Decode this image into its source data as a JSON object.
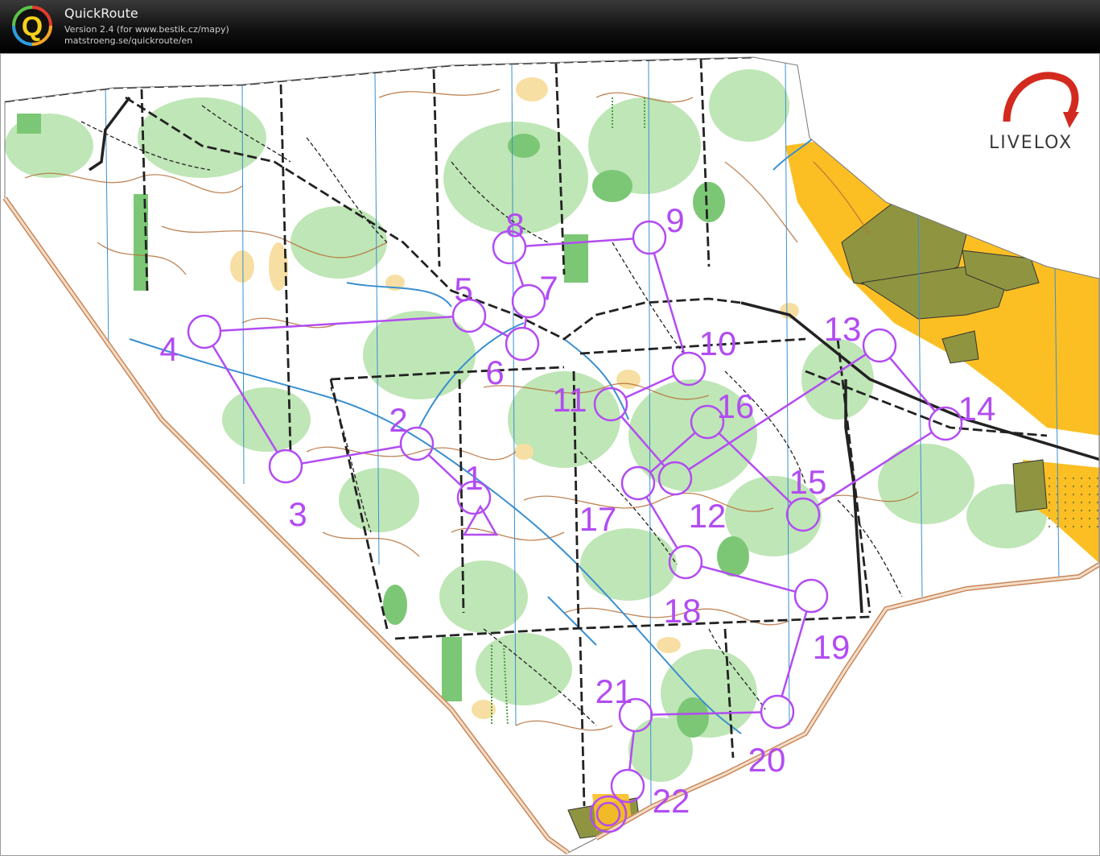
{
  "app": {
    "name": "QuickRoute",
    "version_line": "Version 2.4  (for www.bestik.cz/mapy)",
    "url_line": "matstroeng.se/quickroute/en",
    "logo_letter": "Q"
  },
  "brand": {
    "text": "LIVELOX"
  },
  "colors": {
    "course": "#b24cf2",
    "forest_green": "#a8dba0",
    "dark_green": "#6fbf6a",
    "open_yellow": "#fbbf24",
    "rough_open": "#f7e3a8",
    "olive": "#8f9440",
    "road": "#222222",
    "water": "#3a8fd0",
    "contour": "#b5703a"
  },
  "course": {
    "start_label": "",
    "controls": [
      {
        "number": "1"
      },
      {
        "number": "2"
      },
      {
        "number": "3"
      },
      {
        "number": "4"
      },
      {
        "number": "5"
      },
      {
        "number": "6"
      },
      {
        "number": "7"
      },
      {
        "number": "8"
      },
      {
        "number": "9"
      },
      {
        "number": "10"
      },
      {
        "number": "11"
      },
      {
        "number": "12"
      },
      {
        "number": "13"
      },
      {
        "number": "14"
      },
      {
        "number": "15"
      },
      {
        "number": "16"
      },
      {
        "number": "17"
      },
      {
        "number": "18"
      },
      {
        "number": "19"
      },
      {
        "number": "20"
      },
      {
        "number": "21"
      },
      {
        "number": "22"
      }
    ]
  }
}
